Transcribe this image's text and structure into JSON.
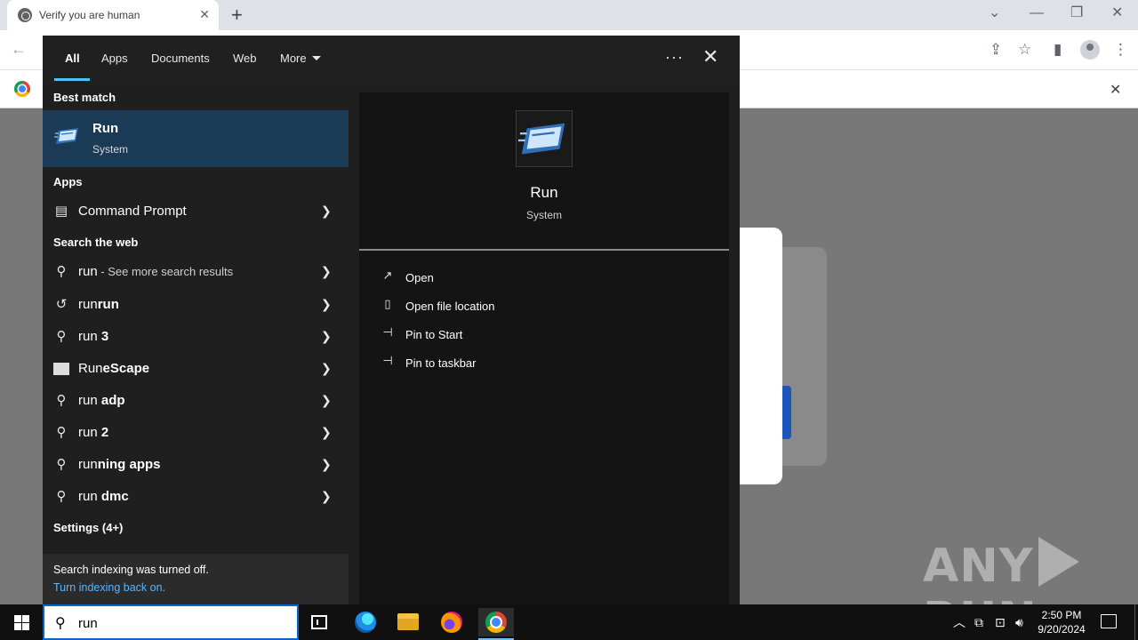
{
  "browser": {
    "tab_title": "Verify you are human",
    "tab_close": "✕",
    "new_tab": "+"
  },
  "search_panel": {
    "filters": [
      "All",
      "Apps",
      "Documents",
      "Web",
      "More"
    ],
    "more_menu": "···",
    "close": "✕",
    "best_match_heading": "Best match",
    "best_match": {
      "title": "Run",
      "subtitle": "System"
    },
    "apps_heading": "Apps",
    "apps": [
      {
        "label": "Command Prompt"
      }
    ],
    "web_heading": "Search the web",
    "web_results": [
      {
        "prefix": "run",
        "suffix": " - See more search results",
        "icon": "search-icon"
      },
      {
        "prefix": "run",
        "bold": "run",
        "icon": "history-icon"
      },
      {
        "prefix": "run",
        "bold": " 3",
        "icon": "search-icon"
      },
      {
        "prefix": "Run",
        "bold": "eScape",
        "icon": "runescape-thumbnail"
      },
      {
        "prefix": "run",
        "bold": " adp",
        "icon": "search-icon"
      },
      {
        "prefix": "run",
        "bold": " 2",
        "icon": "search-icon"
      },
      {
        "prefix": "run",
        "bold": "ning apps",
        "icon": "search-icon"
      },
      {
        "prefix": "run",
        "bold": " dmc",
        "icon": "search-icon"
      }
    ],
    "settings_heading": "Settings (4+)",
    "index_note": {
      "text": "Search indexing was turned off.",
      "link": "Turn indexing back on."
    },
    "preview": {
      "title": "Run",
      "subtitle": "System",
      "actions": [
        {
          "label": "Open",
          "icon": "open-icon"
        },
        {
          "label": "Open file location",
          "icon": "file-location-icon"
        },
        {
          "label": "Pin to Start",
          "icon": "pin-icon"
        },
        {
          "label": "Pin to taskbar",
          "icon": "pin-icon"
        }
      ]
    }
  },
  "taskbar": {
    "search_value": "run",
    "time": "2:50 PM",
    "date": "9/20/2024"
  },
  "watermark": {
    "left": "ANY",
    "right": "RUN"
  },
  "colors": {
    "accent": "#4cc2ff",
    "best_match_bg": "#1b3a56",
    "link": "#5db4ff",
    "taskbar": "#101010"
  }
}
